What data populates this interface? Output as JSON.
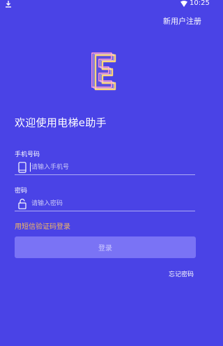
{
  "status_bar": {
    "time": "10:25",
    "icons": [
      "download-icon",
      "wifi-icon"
    ]
  },
  "header": {
    "register_label": "新用户注册"
  },
  "logo": {
    "letter": "E",
    "colors": {
      "fill": "#5a4fe0",
      "outline_pink": "#ff9fd0",
      "outline_gold": "#ffd77a"
    }
  },
  "welcome": {
    "title": "欢迎使用电梯e助手"
  },
  "form": {
    "phone": {
      "label": "手机号码",
      "placeholder": "请输入手机号",
      "value": "",
      "icon": "phone-icon"
    },
    "password": {
      "label": "密码",
      "placeholder": "请输入密码",
      "value": "",
      "icon": "unlock-icon"
    },
    "sms_login_label": "用短信验证码登录",
    "login_button_label": "登录",
    "forgot_password_label": "忘记密码"
  },
  "colors": {
    "background": "#4a43e6",
    "accent_link": "#f4b860",
    "button": "#7a73f5",
    "button_text": "#cfcbff"
  }
}
